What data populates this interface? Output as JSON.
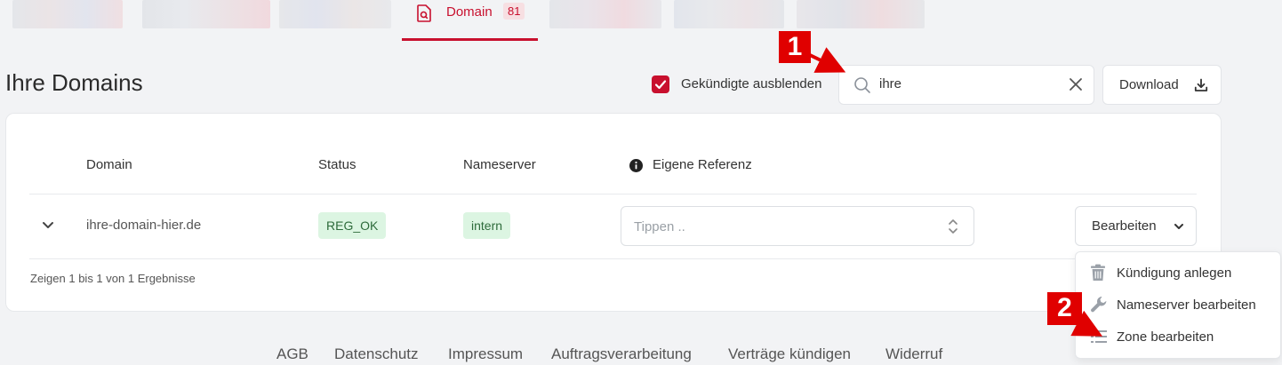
{
  "nav": {
    "active_tab": {
      "label": "Domain",
      "count": "81"
    }
  },
  "header": {
    "title": "Ihre Domains",
    "hide_cancelled": {
      "label": "Gekündigte ausblenden",
      "checked": true
    },
    "search": {
      "value": "ihre"
    },
    "download_label": "Download"
  },
  "table": {
    "columns": [
      "Domain",
      "Status",
      "Nameserver",
      "Eigene Referenz"
    ],
    "rows": [
      {
        "domain": "ihre-domain-hier.de",
        "status": "REG_OK",
        "nameserver": "intern",
        "reference_placeholder": "Tippen .."
      }
    ],
    "edit_label": "Bearbeiten",
    "summary": "Zeigen 1 bis 1 von 1 Ergebnisse"
  },
  "edit_menu": {
    "items": [
      "Kündigung anlegen",
      "Nameserver bearbeiten",
      "Zone bearbeiten"
    ]
  },
  "footer": {
    "links": [
      "AGB",
      "Datenschutz",
      "Impressum",
      "Auftragsverarbeitung",
      "Verträge kündigen",
      "Widerruf"
    ]
  },
  "annotations": {
    "step1": "1",
    "step2": "2",
    "color": "#e00000"
  },
  "colors": {
    "brand": "#c8102e",
    "status_bg": "#dcf5e2"
  }
}
